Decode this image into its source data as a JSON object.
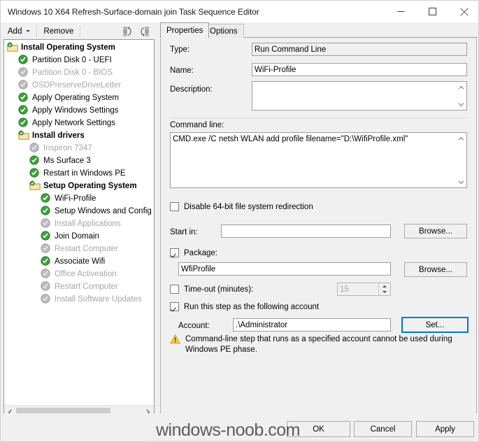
{
  "window": {
    "title": "Windows 10 X64 Refresh-Surface-domain join Task Sequence Editor",
    "minimize_icon": "minimize-icon",
    "maximize_icon": "maximize-icon",
    "close_icon": "close-icon"
  },
  "toolbar": {
    "add_label": "Add",
    "remove_label": "Remove",
    "icon1": "move-up-list-icon",
    "icon2": "move-down-list-icon"
  },
  "tree": {
    "items": [
      {
        "label": "Install Operating System",
        "level": 1,
        "type": "group",
        "state": "enabled"
      },
      {
        "label": "Partition Disk 0 - UEFI",
        "level": 2,
        "type": "step",
        "state": "enabled"
      },
      {
        "label": "Partition Disk 0 - BIOS",
        "level": 2,
        "type": "step",
        "state": "disabled"
      },
      {
        "label": "OSDPreserveDriveLetter",
        "level": 2,
        "type": "step",
        "state": "disabled"
      },
      {
        "label": "Apply Operating System",
        "level": 2,
        "type": "step",
        "state": "enabled"
      },
      {
        "label": "Apply Windows Settings",
        "level": 2,
        "type": "step",
        "state": "enabled"
      },
      {
        "label": "Apply Network Settings",
        "level": 2,
        "type": "step",
        "state": "enabled"
      },
      {
        "label": "Install drivers",
        "level": 2,
        "type": "group",
        "state": "enabled"
      },
      {
        "label": "Inspiron 7347",
        "level": 3,
        "type": "step",
        "state": "disabled"
      },
      {
        "label": "Ms Surface 3",
        "level": 3,
        "type": "step",
        "state": "enabled"
      },
      {
        "label": "Restart in Windows PE",
        "level": 3,
        "type": "step",
        "state": "enabled"
      },
      {
        "label": "Setup Operating System",
        "level": 3,
        "type": "group",
        "state": "enabled"
      },
      {
        "label": "WiFi-Profile",
        "level": 4,
        "type": "step",
        "state": "enabled"
      },
      {
        "label": "Setup Windows and Config",
        "level": 4,
        "type": "step",
        "state": "enabled"
      },
      {
        "label": "Install Applications",
        "level": 4,
        "type": "step",
        "state": "disabled"
      },
      {
        "label": "Join Domain",
        "level": 4,
        "type": "step",
        "state": "enabled"
      },
      {
        "label": "Restart Computer",
        "level": 4,
        "type": "step",
        "state": "disabled"
      },
      {
        "label": "Associate Wifi",
        "level": 4,
        "type": "step",
        "state": "enabled"
      },
      {
        "label": "Office Activeation",
        "level": 4,
        "type": "step",
        "state": "disabled"
      },
      {
        "label": "Restart Computer",
        "level": 4,
        "type": "step",
        "state": "disabled"
      },
      {
        "label": "Install Software Updates",
        "level": 4,
        "type": "step",
        "state": "disabled"
      }
    ],
    "scroll_left_icon": "chevron-left-icon",
    "scroll_right_icon": "chevron-right-icon"
  },
  "tabs": [
    {
      "label": "Properties",
      "active": true
    },
    {
      "label": "Options",
      "active": false
    }
  ],
  "form": {
    "type_label": "Type:",
    "type_value": "Run Command Line",
    "name_label": "Name:",
    "name_value": "WiFi-Profile",
    "description_label": "Description:",
    "description_value": "",
    "command_line_label": "Command line:",
    "command_line_value": "CMD.exe /C netsh WLAN add profile filename=\"D:\\WifiProfile.xml\"",
    "disable_redirection_label": "Disable 64-bit file system redirection",
    "disable_redirection_checked": false,
    "start_in_label": "Start in:",
    "start_in_value": "",
    "start_in_browse_label": "Browse...",
    "package_label": "Package:",
    "package_checked": true,
    "package_value": "WfiProfile",
    "package_browse_label": "Browse...",
    "timeout_label": "Time-out (minutes):",
    "timeout_checked": false,
    "timeout_value": "15",
    "run_as_label": "Run this step as the following account",
    "run_as_checked": true,
    "account_label": "Account:",
    "account_value": ".\\Administrator",
    "set_label": "Set...",
    "warning_icon": "warning-triangle-icon",
    "warning_text": "Command-line step that runs as a specified account cannot be used during Windows PE phase."
  },
  "footer": {
    "ok_label": "OK",
    "cancel_label": "Cancel",
    "apply_label": "Apply"
  },
  "watermark": {
    "text": "windows-noob.com"
  },
  "colors": {
    "accent": "#0078d7",
    "window_bg": "#f0f0f0",
    "enabled_icon": "#35a035",
    "disabled_icon": "#b4b4b4",
    "folder": "#f8d576",
    "warning": "#f4c430",
    "disabled_text": "#a6a6a6"
  }
}
